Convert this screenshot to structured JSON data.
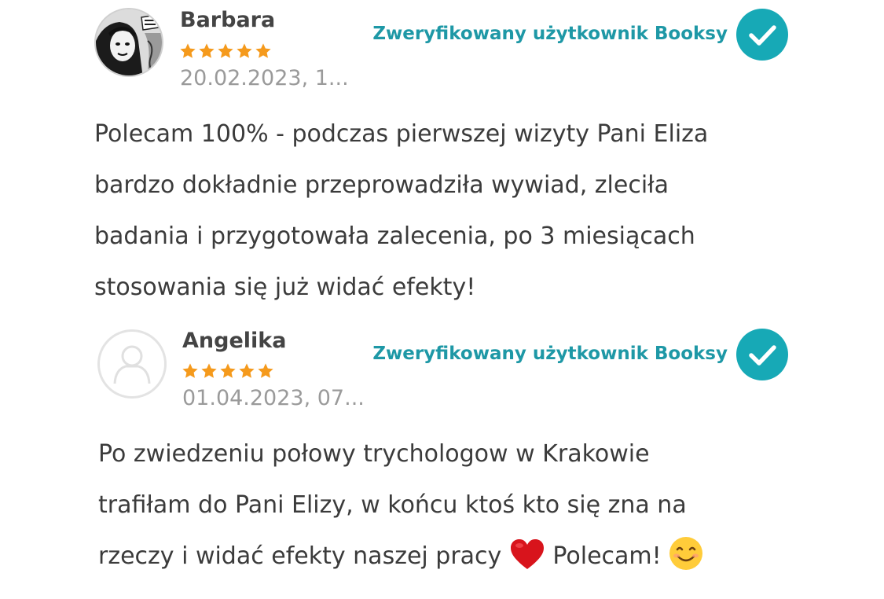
{
  "reviews": [
    {
      "author": "Barbara",
      "rating": 5,
      "date": "20.02.2023, 1...",
      "verified_label": "Zweryfikowany użytkownik Booksy",
      "avatar_icon": "comic-photo-avatar",
      "text_lines": [
        "Polecam 100% - podczas pierwszej wizyty Pani Eliza",
        "bardzo dokładnie przeprowadziła wywiad, zleciła",
        "badania i przygotowała zalecenia, po 3 miesiącach",
        "stosowania się już widać efekty!"
      ]
    },
    {
      "author": "Angelika",
      "rating": 5,
      "date": "01.04.2023, 07...",
      "verified_label": "Zweryfikowany użytkownik Booksy",
      "avatar_icon": "user-placeholder-icon",
      "text_lines": [
        "Po zwiedzeniu połowy trychologow w Krakowie",
        "trafiłam do Pani Elizy, w końcu ktoś kto się zna na",
        "rzeczy i widać efekty naszej pracy",
        "Polecam!"
      ]
    }
  ],
  "colors": {
    "star": "#f59a1c",
    "verified_text": "#1e98a6",
    "check_badge": "#17a9b6",
    "heart": "#d8141c",
    "smile": "#ffcc3a"
  }
}
